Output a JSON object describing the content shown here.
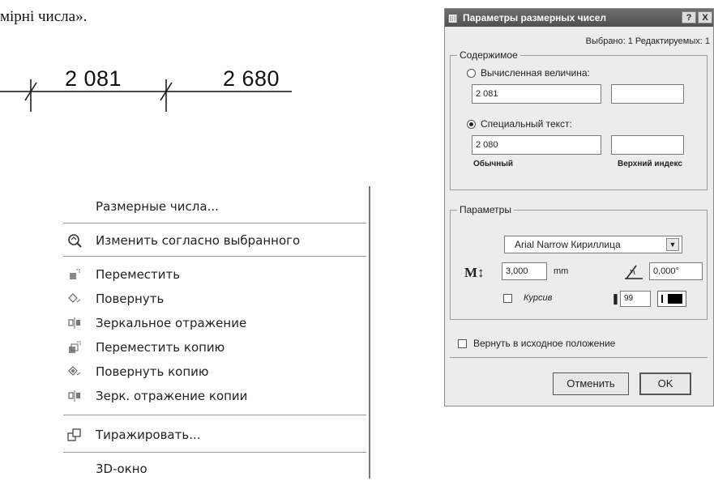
{
  "doc_text": "мірні числа».",
  "dimensions": {
    "left_value": "2 081",
    "right_value": "2 680"
  },
  "menu": {
    "items": [
      {
        "icon": "none",
        "label": "Размерные числа..."
      },
      {
        "icon": "magnifier-icon",
        "label": "Изменить согласно выбранного"
      },
      {
        "icon": "move-icon",
        "label": "Переместить"
      },
      {
        "icon": "rotate-icon",
        "label": "Повернуть"
      },
      {
        "icon": "mirror-icon",
        "label": "Зеркальное отражение"
      },
      {
        "icon": "move-copy-icon",
        "label": "Переместить копию"
      },
      {
        "icon": "rotate-copy-icon",
        "label": "Повернуть копию"
      },
      {
        "icon": "mirror-copy-icon",
        "label": "Зерк. отражение копии"
      },
      {
        "icon": "duplicate-icon",
        "label": "Тиражировать..."
      },
      {
        "icon": "none",
        "label": "3D-окно"
      }
    ]
  },
  "dialog": {
    "title": "Параметры размерных чисел",
    "help_label": "?",
    "close_label": "X",
    "status": "Выбрано: 1 Редактируемых: 1",
    "content_group": {
      "label": "Содержимое",
      "computed_label": "Вычисленная величина:",
      "computed_value": "2 081",
      "computed_extra": "",
      "special_label": "Специальный текст:",
      "special_value": "2 080",
      "special_extra": "",
      "normal_caption": "Обычный",
      "superscript_caption": "Верхний индекс",
      "selected": "special"
    },
    "params_group": {
      "label": "Параметры",
      "font": "Arial Narrow Кириллица",
      "size_value": "3,000",
      "size_unit": "mm",
      "angle_value": "0,000°",
      "italic_label": "Курсив",
      "italic_checked": false,
      "pen_value": "99"
    },
    "reset_label": "Вернуть в исходное положение",
    "reset_checked": false,
    "cancel_label": "Отменить",
    "ok_label": "OK"
  }
}
